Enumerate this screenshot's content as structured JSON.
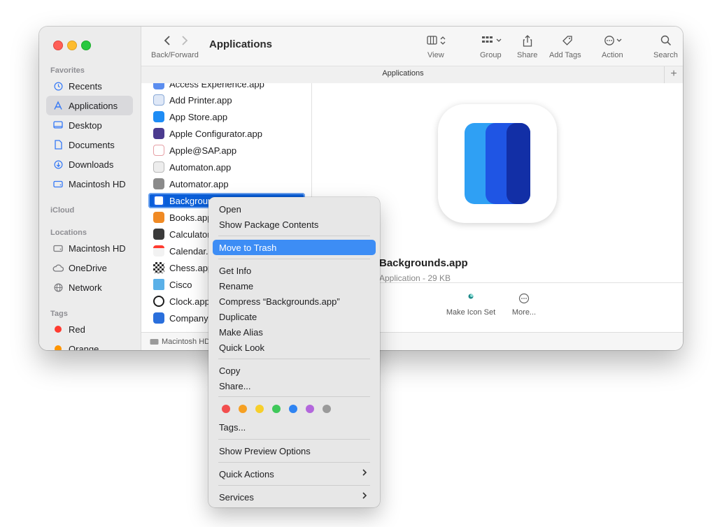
{
  "window": {
    "title": "Applications",
    "nav_label": "Back/Forward",
    "tab_label": "Applications",
    "tab_add": "+"
  },
  "toolbar": {
    "view": "View",
    "group": "Group",
    "share": "Share",
    "add_tags": "Add Tags",
    "action": "Action",
    "search": "Search"
  },
  "sidebar": {
    "favorites_header": "Favorites",
    "favorites": [
      {
        "label": "Recents",
        "icon": "clock-icon"
      },
      {
        "label": "Applications",
        "icon": "applications-icon",
        "selected": true
      },
      {
        "label": "Desktop",
        "icon": "desktop-icon"
      },
      {
        "label": "Documents",
        "icon": "document-icon"
      },
      {
        "label": "Downloads",
        "icon": "download-icon"
      },
      {
        "label": "Macintosh HD",
        "icon": "disk-icon"
      }
    ],
    "icloud_header": "iCloud",
    "locations_header": "Locations",
    "locations": [
      {
        "label": "Macintosh HD",
        "icon": "disk-icon"
      },
      {
        "label": "OneDrive",
        "icon": "cloud-icon"
      },
      {
        "label": "Network",
        "icon": "network-icon"
      }
    ],
    "tags_header": "Tags",
    "tags": [
      {
        "label": "Red",
        "color": "#ff3b30"
      },
      {
        "label": "Orange",
        "color": "#ff9500"
      }
    ]
  },
  "files": [
    {
      "name": "Access Experience.app",
      "color": "#5b8def"
    },
    {
      "name": "Add Printer.app",
      "color": "#8aa9d6"
    },
    {
      "name": "App Store.app",
      "color": "#1e8cf5"
    },
    {
      "name": "Apple Configurator.app",
      "color": "#4b3b8f"
    },
    {
      "name": "Apple@SAP.app",
      "color": "#e6a0a6"
    },
    {
      "name": "Automaton.app",
      "color": "#b9b9b9"
    },
    {
      "name": "Automator.app",
      "color": "#8a8a8a"
    },
    {
      "name": "Backgrounds.app",
      "color": "#1b64e6",
      "selected": true
    },
    {
      "name": "Books.app",
      "color": "#f08a24"
    },
    {
      "name": "Calculator.app",
      "color": "#3a3a3a"
    },
    {
      "name": "Calendar.app",
      "color": "#f2f2f2"
    },
    {
      "name": "Chess.app",
      "color": "#2f2f2f"
    },
    {
      "name": "Cisco",
      "color": "#5ab0e8"
    },
    {
      "name": "Clock.app",
      "color": "#1c1c1c"
    },
    {
      "name": "Company Portal.app",
      "color": "#2a6fdc"
    }
  ],
  "preview": {
    "name": "Backgrounds.app",
    "size": "Application - 29 KB",
    "accent1": "#2fa0f4",
    "accent2": "#1f55e4",
    "accent3": "#122fa6"
  },
  "quick_actions": [
    {
      "label": "Make Icon Set",
      "icon": "icon-set-icon"
    },
    {
      "label": "More...",
      "icon": "ellipsis-icon"
    }
  ],
  "pathbar": {
    "disk": "Macintosh HD"
  },
  "context_menu": {
    "items": [
      "Open",
      "Show Package Contents",
      "Move to Trash",
      "Get Info",
      "Rename",
      "Compress “Backgrounds.app”",
      "Duplicate",
      "Make Alias",
      "Quick Look",
      "Copy",
      "Share...",
      "Tags...",
      "Show Preview Options",
      "Quick Actions",
      "Services"
    ],
    "highlighted": "Move to Trash",
    "tag_colors": [
      "#f24e4e",
      "#f6a023",
      "#f7cf2b",
      "#3fc85a",
      "#2f84f2",
      "#b367dc",
      "#9a9a9a"
    ]
  }
}
